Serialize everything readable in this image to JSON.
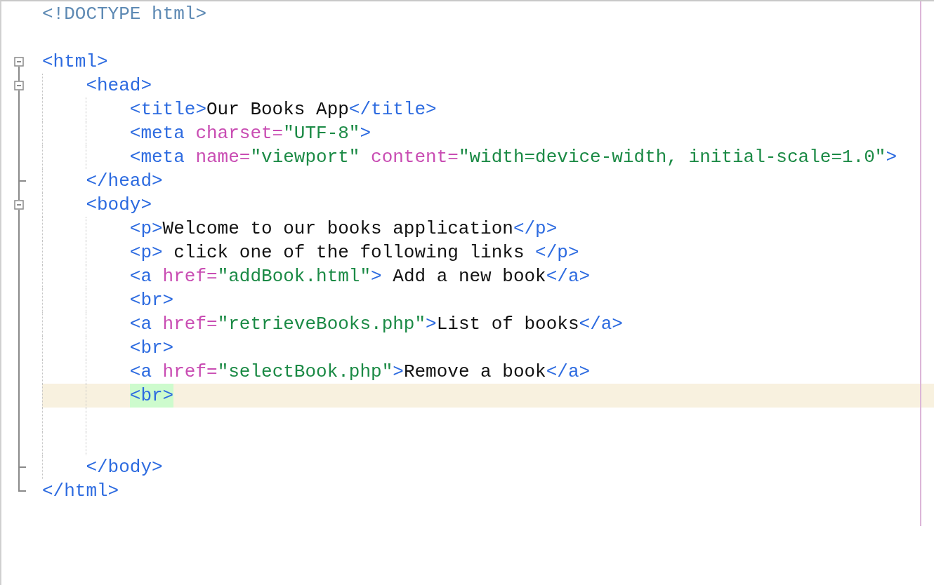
{
  "editor": {
    "lines": [
      {
        "kind": "code",
        "current": false,
        "tokens": [
          {
            "kind": "doctype",
            "text": "<!DOCTYPE html>"
          }
        ]
      },
      {
        "kind": "blank",
        "current": false
      },
      {
        "kind": "fold_start",
        "current": false,
        "expanded": true,
        "tokens": [
          {
            "kind": "tag",
            "text": "<html>"
          }
        ],
        "children": [
          {
            "kind": "fold_start",
            "current": false,
            "expanded": true,
            "tokens": [
              {
                "kind": "tag",
                "text": "<head>"
              }
            ],
            "children": [
              {
                "kind": "code",
                "current": false,
                "tokens": [
                  {
                    "kind": "tag",
                    "text": "<title>"
                  },
                  {
                    "kind": "text",
                    "text": "Our Books App"
                  },
                  {
                    "kind": "tag",
                    "text": "</title>"
                  }
                ]
              },
              {
                "kind": "code",
                "current": false,
                "tokens": [
                  {
                    "kind": "tag",
                    "text": "<meta"
                  },
                  {
                    "kind": "attr",
                    "text": " charset="
                  },
                  {
                    "kind": "value",
                    "text": "\"UTF-8\""
                  },
                  {
                    "kind": "tag",
                    "text": ">"
                  }
                ]
              },
              {
                "kind": "code",
                "current": false,
                "tokens": [
                  {
                    "kind": "tag",
                    "text": "<meta"
                  },
                  {
                    "kind": "attr",
                    "text": " name="
                  },
                  {
                    "kind": "value",
                    "text": "\"viewport\""
                  },
                  {
                    "kind": "attr",
                    "text": " content="
                  },
                  {
                    "kind": "value",
                    "text": "\"width=device-width, initial-scale=1.0\""
                  },
                  {
                    "kind": "tag",
                    "text": ">"
                  }
                ]
              }
            ]
          },
          {
            "kind": "fold_end",
            "current": false,
            "tokens": [
              {
                "kind": "tag",
                "text": "</head>"
              }
            ]
          },
          {
            "kind": "fold_start",
            "current": false,
            "expanded": true,
            "tokens": [
              {
                "kind": "tag",
                "text": "<body>"
              }
            ],
            "children": [
              {
                "kind": "code",
                "current": false,
                "tokens": [
                  {
                    "kind": "tag",
                    "text": "<p>"
                  },
                  {
                    "kind": "text",
                    "text": "Welcome to our books application"
                  },
                  {
                    "kind": "tag",
                    "text": "</p>"
                  }
                ]
              },
              {
                "kind": "code",
                "current": false,
                "tokens": [
                  {
                    "kind": "tag",
                    "text": "<p>"
                  },
                  {
                    "kind": "text",
                    "text": " click one of the following links "
                  },
                  {
                    "kind": "tag",
                    "text": "</p>"
                  }
                ]
              },
              {
                "kind": "code",
                "current": false,
                "tokens": [
                  {
                    "kind": "tag",
                    "text": "<a"
                  },
                  {
                    "kind": "attr",
                    "text": " href="
                  },
                  {
                    "kind": "value",
                    "text": "\"addBook.html\""
                  },
                  {
                    "kind": "tag",
                    "text": ">"
                  },
                  {
                    "kind": "text",
                    "text": " Add a new book"
                  },
                  {
                    "kind": "tag",
                    "text": "</a>"
                  }
                ]
              },
              {
                "kind": "code",
                "current": false,
                "tokens": [
                  {
                    "kind": "tag",
                    "text": "<br>"
                  }
                ]
              },
              {
                "kind": "code",
                "current": false,
                "tokens": [
                  {
                    "kind": "tag",
                    "text": "<a"
                  },
                  {
                    "kind": "attr",
                    "text": " href="
                  },
                  {
                    "kind": "value",
                    "text": "\"retrieveBooks.php\""
                  },
                  {
                    "kind": "tag",
                    "text": ">"
                  },
                  {
                    "kind": "text",
                    "text": "List of books"
                  },
                  {
                    "kind": "tag",
                    "text": "</a>"
                  }
                ]
              },
              {
                "kind": "code",
                "current": false,
                "tokens": [
                  {
                    "kind": "tag",
                    "text": "<br>"
                  }
                ]
              },
              {
                "kind": "code",
                "current": false,
                "tokens": [
                  {
                    "kind": "tag",
                    "text": "<a"
                  },
                  {
                    "kind": "attr",
                    "text": " href="
                  },
                  {
                    "kind": "value",
                    "text": "\"selectBook.php\""
                  },
                  {
                    "kind": "tag",
                    "text": ">"
                  },
                  {
                    "kind": "text",
                    "text": "Remove a book"
                  },
                  {
                    "kind": "tag",
                    "text": "</a>"
                  }
                ]
              },
              {
                "kind": "code",
                "current": true,
                "tokens": [
                  {
                    "kind": "tag",
                    "text": "<br>",
                    "matched": true
                  }
                ]
              },
              {
                "kind": "blank",
                "current": false
              },
              {
                "kind": "blank",
                "current": false
              }
            ]
          },
          {
            "kind": "fold_end",
            "current": false,
            "tokens": [
              {
                "kind": "tag",
                "text": "</body>"
              }
            ]
          }
        ]
      },
      {
        "kind": "fold_end",
        "current": false,
        "tokens": [
          {
            "kind": "tag",
            "text": "</html>"
          }
        ]
      }
    ]
  }
}
